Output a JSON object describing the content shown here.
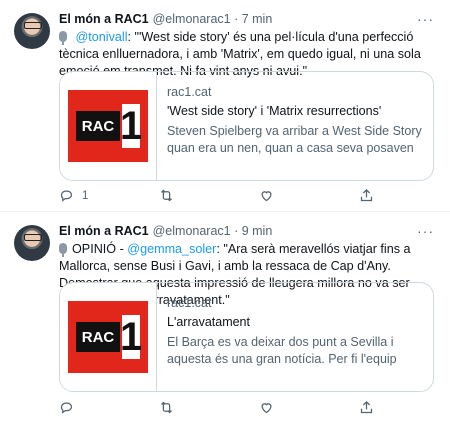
{
  "colors": {
    "accent": "#1d9bf0",
    "muted": "#536471",
    "brand_red": "#e1261c"
  },
  "tweets": [
    {
      "author": "El món a RAC1",
      "handle": "@elmonarac1 · 7 min",
      "text_parts": {
        "prefix": " ",
        "mention": "@tonivall",
        "body": ": \"'West side story' és una pel·lícula d'una perfecció tècnica enlluernadora, i amb 'Matrix', em quedo igual, ni una sola emoció em transmet. Ni fa vint anys ni avui.\""
      },
      "card": {
        "logo_text": "RAC",
        "logo_number": "1",
        "domain": "rac1.cat",
        "title": "'West side story' i 'Matrix resurrections'",
        "description": "Steven Spielberg va arribar a West Side Story quan era un nen, quan a casa seva posaven el disc amb ..."
      },
      "reply_count": "1",
      "icons": [
        "reply-icon",
        "retweet-icon",
        "like-icon",
        "share-icon"
      ]
    },
    {
      "author": "El món a RAC1",
      "handle": "@elmonarac1 · 9 min",
      "text_parts": {
        "prefix": "OPINIÓ - ",
        "mention": "@gemma_soler",
        "body": ": \"Ara serà meravellós viatjar fins a Mallorca, sense Busi i Gavi, i amb la ressaca de Cap d'Any. Demostrar que aquesta impressió de lleugera millora no va ser només fruit de l'arravatament.\""
      },
      "card": {
        "logo_text": "RAC",
        "logo_number": "1",
        "domain": "rac1.cat",
        "title": "L'arravatament",
        "description": "El Barça es va deixar dos punt a Sevilla i aquesta és una gran notícia. Per fi l'equip blaugrana acaba un ..."
      },
      "reply_count": "",
      "icons": [
        "reply-icon",
        "retweet-icon",
        "like-icon",
        "share-icon"
      ]
    }
  ]
}
